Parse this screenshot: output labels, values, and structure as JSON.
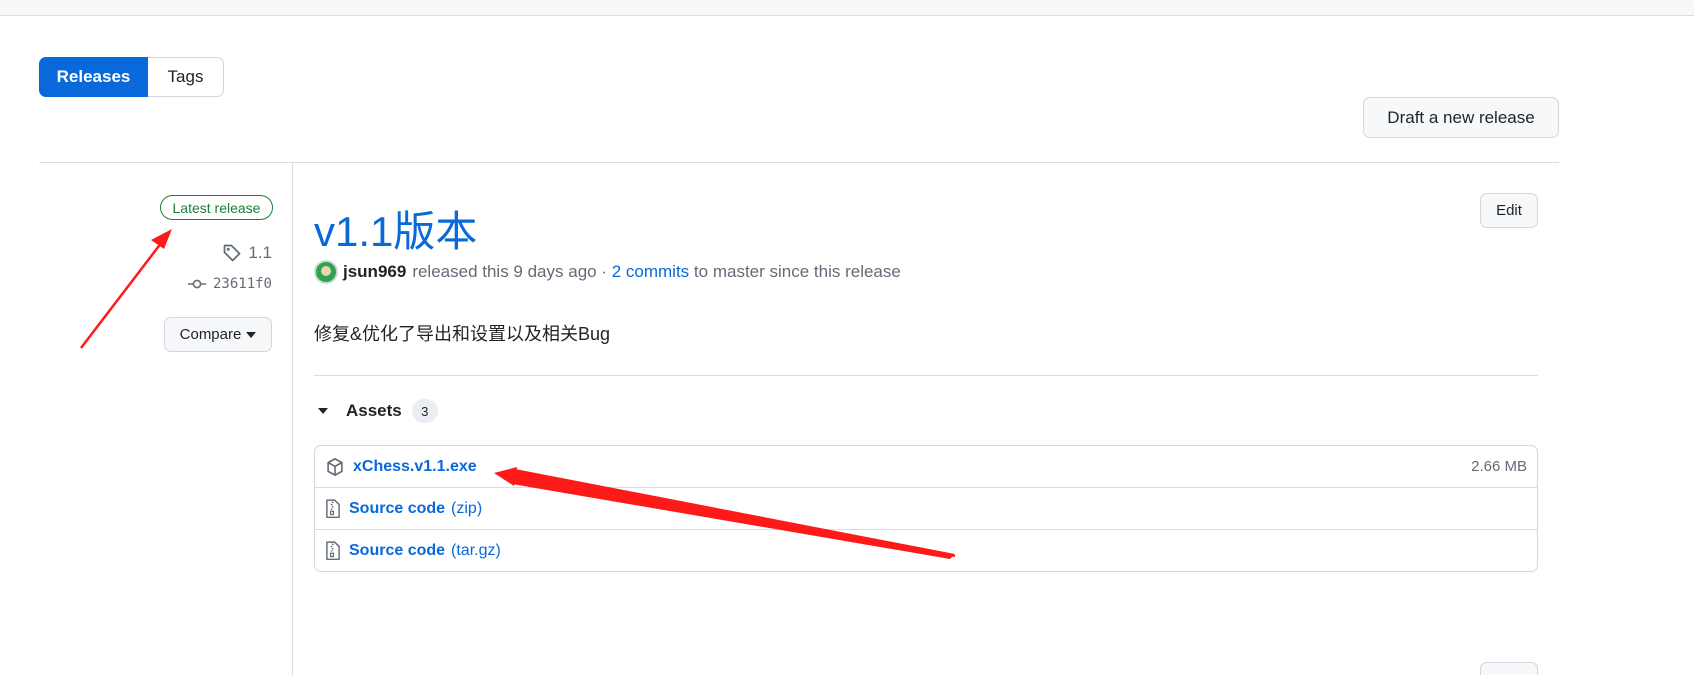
{
  "subnav": {
    "releases_label": "Releases",
    "tags_label": "Tags"
  },
  "actions": {
    "draft_label": "Draft a new release",
    "edit_label": "Edit"
  },
  "sidebar": {
    "latest_badge": "Latest release",
    "tag": "1.1",
    "commit": "23611f0",
    "compare_label": "Compare"
  },
  "release": {
    "title": "v1.1版本",
    "author": "jsun969",
    "released_text": "released this 9 days ago ·",
    "commits_link": "2 commits",
    "commits_suffix": "to master since this release",
    "body": "修复&优化了导出和设置以及相关Bug"
  },
  "assets": {
    "heading": "Assets",
    "count": "3",
    "items": [
      {
        "name": "xChess.v1.1.exe",
        "ext": "",
        "size": "2.66 MB",
        "icon": "package-icon"
      },
      {
        "name": "Source code",
        "ext": "(zip)",
        "size": "",
        "icon": "file-zip-icon"
      },
      {
        "name": "Source code",
        "ext": "(tar.gz)",
        "size": "",
        "icon": "file-zip-icon"
      }
    ]
  },
  "colors": {
    "accent": "#0969da",
    "success": "#1a7f37",
    "annotation": "#ff1a1a"
  }
}
